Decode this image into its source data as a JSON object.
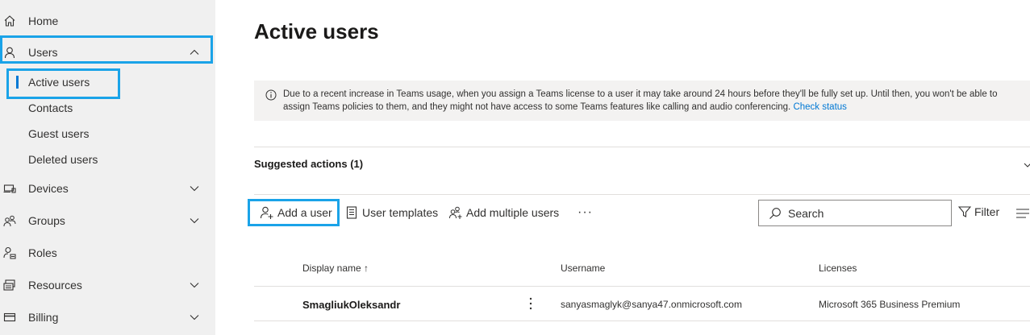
{
  "sidebar": {
    "home": "Home",
    "users": "Users",
    "users_sub": {
      "active": "Active users",
      "contacts": "Contacts",
      "guest": "Guest users",
      "deleted": "Deleted users"
    },
    "devices": "Devices",
    "groups": "Groups",
    "roles": "Roles",
    "resources": "Resources",
    "billing": "Billing"
  },
  "main": {
    "title": "Active users",
    "notice": {
      "text": "Due to a recent increase in Teams usage, when you assign a Teams license to a user it may take around 24 hours before they'll be fully set up. Until then, you won't be able to assign Teams policies to them, and they might not have access to some Teams features like calling and audio conferencing. ",
      "link": "Check status"
    },
    "suggested_actions": "Suggested actions (1)",
    "toolbar": {
      "add_user": "Add a user",
      "user_templates": "User templates",
      "add_multiple": "Add multiple users",
      "more": "···",
      "search_placeholder": "Search",
      "filter": "Filter"
    },
    "table": {
      "columns": {
        "display_name": "Display name ↑",
        "username": "Username",
        "licenses": "Licenses"
      },
      "rows": [
        {
          "display_name": "SmagliukOleksandr",
          "username": "sanyasmaglyk@sanya47.onmicrosoft.com",
          "licenses": "Microsoft 365 Business Premium"
        }
      ]
    }
  },
  "colors": {
    "highlight": "#1aa3e8",
    "accent": "#0078d4",
    "sidebar_bg": "#f0f0f0",
    "notice_bg": "#f3f2f1"
  }
}
